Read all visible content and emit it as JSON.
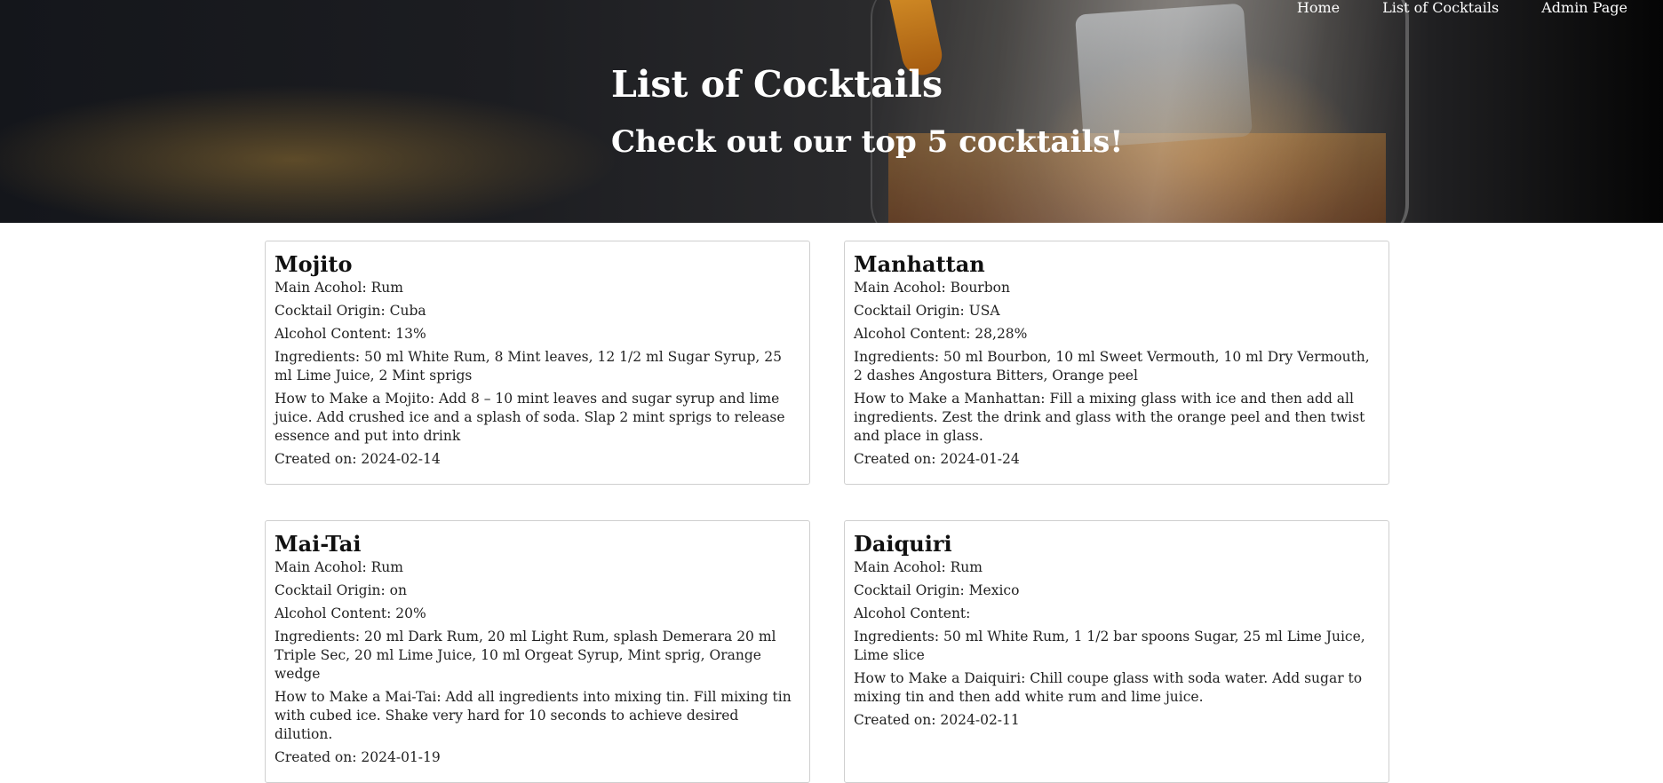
{
  "nav": {
    "home": "Home",
    "list": "List of Cocktails",
    "admin": "Admin Page"
  },
  "hero": {
    "title": "List of Cocktails",
    "subtitle": "Check out our top 5 cocktails!"
  },
  "cocktails": [
    {
      "name": "Mojito",
      "main_alcohol": "Main Acohol: Rum",
      "origin": "Cocktail Origin: Cuba",
      "alcohol_content": "Alcohol Content: 13%",
      "ingredients": "Ingredients: 50 ml White Rum, 8 Mint leaves, 12 1/2 ml Sugar Syrup, 25 ml Lime Juice, 2 Mint sprigs",
      "how_to": "How to Make a Mojito: Add 8 – 10 mint leaves and sugar syrup and lime juice. Add crushed ice and a splash of soda. Slap 2 mint sprigs to release essence and put into drink",
      "created": "Created on: 2024-02-14"
    },
    {
      "name": "Manhattan",
      "main_alcohol": "Main Acohol: Bourbon",
      "origin": "Cocktail Origin: USA",
      "alcohol_content": "Alcohol Content: 28,28%",
      "ingredients": "Ingredients: 50 ml Bourbon, 10 ml Sweet Vermouth, 10 ml Dry Vermouth, 2 dashes Angostura Bitters, Orange peel",
      "how_to": "How to Make a Manhattan: Fill a mixing glass with ice and then add all ingredients. Zest the drink and glass with the orange peel and then twist and place in glass.",
      "created": "Created on: 2024-01-24"
    },
    {
      "name": "Mai-Tai",
      "main_alcohol": "Main Acohol: Rum",
      "origin": "Cocktail Origin: on",
      "alcohol_content": "Alcohol Content: 20%",
      "ingredients": "Ingredients: 20 ml Dark Rum, 20 ml Light Rum, splash Demerara 20 ml Triple Sec, 20 ml Lime Juice, 10 ml Orgeat Syrup, Mint sprig, Orange wedge",
      "how_to": "How to Make a Mai-Tai: Add all ingredients into mixing tin. Fill mixing tin with cubed ice. Shake very hard for 10 seconds to achieve desired dilution.",
      "created": "Created on: 2024-01-19"
    },
    {
      "name": "Daiquiri",
      "main_alcohol": "Main Acohol: Rum",
      "origin": "Cocktail Origin: Mexico",
      "alcohol_content": "Alcohol Content:",
      "ingredients": "Ingredients: 50 ml White Rum, 1 1/2 bar spoons Sugar, 25 ml Lime Juice, Lime slice",
      "how_to": "How to Make a Daiquiri: Chill coupe glass with soda water. Add sugar to mixing tin and then add white rum and lime juice.",
      "created": "Created on: 2024-02-11"
    }
  ]
}
